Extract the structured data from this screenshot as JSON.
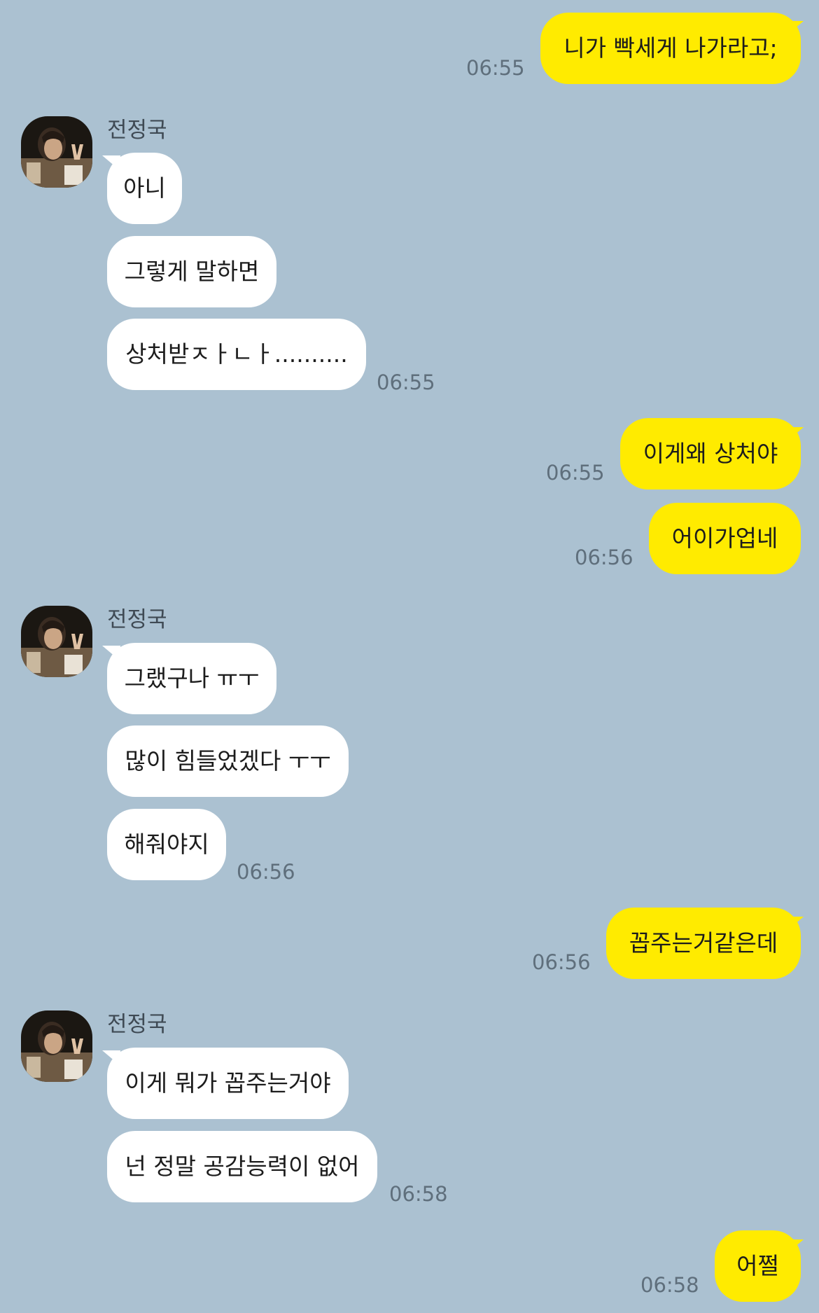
{
  "contact": {
    "name": "전정국",
    "avatar_icon": "profile-photo"
  },
  "colors": {
    "background": "#abc1d1",
    "outgoing": "#ffeb00",
    "incoming": "#ffffff"
  },
  "messages": {
    "m1": "니가 빡세게 나가라고;",
    "m2": "아니",
    "m3": "그렇게 말하면",
    "m4": "상처받ㅈㅏㄴㅏ..........",
    "m5": "이게왜 상처야",
    "m6": "어이가업네",
    "m7": "그랬구나 ㅠㅜ",
    "m8": "많이 힘들었겠다 ㅜㅜ",
    "m9": "해줘야지",
    "m10": "꼽주는거같은데",
    "m11": "이게 뭐가 꼽주는거야",
    "m12": "넌 정말 공감능력이 없어",
    "m13": "어쩔"
  },
  "times": {
    "t1": "06:55",
    "t2": "06:55",
    "t3": "06:55",
    "t4": "06:56",
    "t5": "06:56",
    "t6": "06:56",
    "t7": "06:58",
    "t8": "06:58"
  }
}
